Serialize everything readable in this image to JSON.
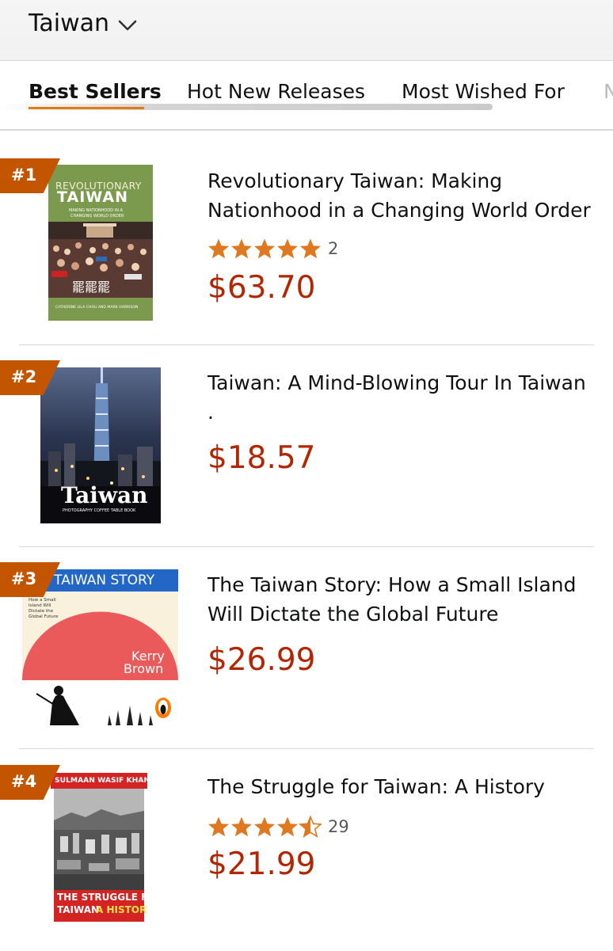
{
  "header": {
    "category": "Taiwan"
  },
  "tabs": [
    {
      "label": "Best Sellers"
    },
    {
      "label": "Hot New Releases"
    },
    {
      "label": "Most Wished For"
    },
    {
      "label": "N"
    }
  ],
  "items": [
    {
      "rank": "#1",
      "title": "Revolutionary Taiwan: Making Nationhood in a Changing World Order",
      "rating": 5,
      "review_count": "2",
      "price": "$63.70",
      "cover": {
        "line1": "REVOLUTIONARY",
        "line2": "TAIWAN",
        "sub1": "MAKING NATIONHOOD IN A",
        "sub2": "CHANGING WORLD ORDER",
        "authors": "CATHERINE LILA CHOU AND MARK HARRISON"
      }
    },
    {
      "rank": "#2",
      "title": "Taiwan: A Mind-Blowing Tour In Taiwan .",
      "price": "$18.57",
      "cover": {
        "title": "Taiwan",
        "subtitle": "PHOTOGRAPHY COFFEE TABLE BOOK"
      }
    },
    {
      "rank": "#3",
      "title": "The Taiwan Story: How a Small Island Will Dictate the Global Future",
      "price": "$26.99",
      "cover": {
        "banner": "E TAIWAN STORY",
        "tagline1": "How a Small",
        "tagline2": "Island Will",
        "tagline3": "Dictate the",
        "tagline4": "Global Future",
        "author1": "Kerry",
        "author2": "Brown"
      }
    },
    {
      "rank": "#4",
      "title": "The Struggle for Taiwan: A History",
      "rating": 4.5,
      "review_count": "29",
      "price": "$21.99",
      "cover": {
        "author": "SULMAAN WASIF KHAN",
        "title1": "THE STRUGGLE FOR",
        "title2": "TAIWAN",
        "title3": "A HISTORY"
      }
    }
  ],
  "colors": {
    "badge": "#c45500",
    "price": "#b12704",
    "star": "#de7921",
    "tab_underline": "#e47911"
  }
}
